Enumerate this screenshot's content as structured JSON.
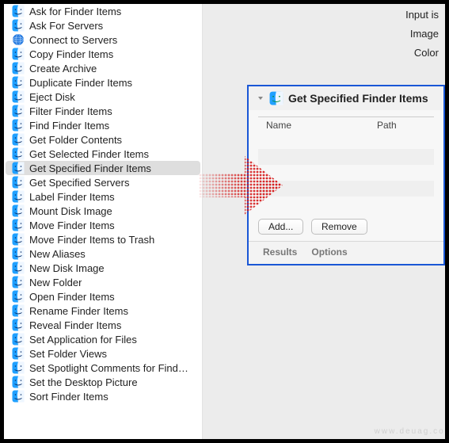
{
  "sidebar": {
    "items": [
      {
        "label": "Ask for Finder Items",
        "icon": "finder"
      },
      {
        "label": "Ask For Servers",
        "icon": "finder"
      },
      {
        "label": "Connect to Servers",
        "icon": "network"
      },
      {
        "label": "Copy Finder Items",
        "icon": "finder"
      },
      {
        "label": "Create Archive",
        "icon": "finder"
      },
      {
        "label": "Duplicate Finder Items",
        "icon": "finder"
      },
      {
        "label": "Eject Disk",
        "icon": "finder"
      },
      {
        "label": "Filter Finder Items",
        "icon": "finder"
      },
      {
        "label": "Find Finder Items",
        "icon": "finder"
      },
      {
        "label": "Get Folder Contents",
        "icon": "finder"
      },
      {
        "label": "Get Selected Finder Items",
        "icon": "finder"
      },
      {
        "label": "Get Specified Finder Items",
        "icon": "finder",
        "selected": true
      },
      {
        "label": "Get Specified Servers",
        "icon": "finder"
      },
      {
        "label": "Label Finder Items",
        "icon": "finder"
      },
      {
        "label": "Mount Disk Image",
        "icon": "finder"
      },
      {
        "label": "Move Finder Items",
        "icon": "finder"
      },
      {
        "label": "Move Finder Items to Trash",
        "icon": "finder"
      },
      {
        "label": "New Aliases",
        "icon": "finder"
      },
      {
        "label": "New Disk Image",
        "icon": "finder"
      },
      {
        "label": "New Folder",
        "icon": "finder"
      },
      {
        "label": "Open Finder Items",
        "icon": "finder"
      },
      {
        "label": "Rename Finder Items",
        "icon": "finder"
      },
      {
        "label": "Reveal Finder Items",
        "icon": "finder"
      },
      {
        "label": "Set Application for Files",
        "icon": "finder"
      },
      {
        "label": "Set Folder Views",
        "icon": "finder"
      },
      {
        "label": "Set Spotlight Comments for Finder Items",
        "icon": "finder"
      },
      {
        "label": "Set the Desktop Picture",
        "icon": "finder"
      },
      {
        "label": "Sort Finder Items",
        "icon": "finder"
      }
    ]
  },
  "header": {
    "input_label": "Input is",
    "line2": "Image",
    "line3": "Color"
  },
  "card": {
    "title": "Get Specified Finder Items",
    "columns": {
      "name": "Name",
      "path": "Path"
    },
    "rows": [],
    "buttons": {
      "add": "Add...",
      "remove": "Remove"
    },
    "footer": {
      "results": "Results",
      "options": "Options"
    }
  },
  "arrow_color": "#d41414",
  "watermark": "www.deuag.com"
}
